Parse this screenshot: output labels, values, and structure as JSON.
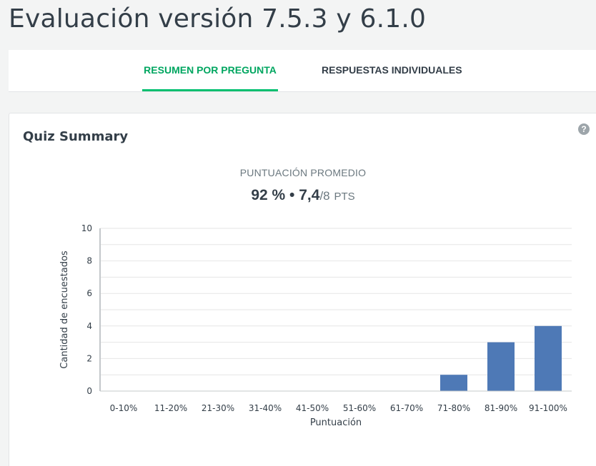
{
  "page": {
    "title": "Evaluación versión 7.5.3 y 6.1.0"
  },
  "tabs": [
    {
      "label": "RESUMEN POR PREGUNTA",
      "active": true
    },
    {
      "label": "RESPUESTAS INDIVIDUALES",
      "active": false
    }
  ],
  "card": {
    "title": "Quiz Summary",
    "help_icon": "question-circle-icon",
    "avg_label": "PUNTUACIÓN PROMEDIO",
    "avg_percent": "92 %",
    "avg_separator": "•",
    "avg_points": "7,4",
    "avg_points_total": "/8",
    "avg_points_unit": "PTS"
  },
  "colors": {
    "accent_green": "#00bf6f",
    "bar_blue": "#4e79b6",
    "text_dark": "#333e48"
  },
  "chart_data": {
    "type": "bar",
    "categories": [
      "0-10%",
      "11-20%",
      "21-30%",
      "31-40%",
      "41-50%",
      "51-60%",
      "61-70%",
      "71-80%",
      "81-90%",
      "91-100%"
    ],
    "values": [
      0,
      0,
      0,
      0,
      0,
      0,
      0,
      1,
      3,
      4
    ],
    "xlabel": "Puntuación",
    "ylabel": "Cantidad de encuestados",
    "ylim": [
      0,
      10
    ],
    "yticks": [
      0,
      2,
      4,
      6,
      8,
      10
    ],
    "grid": true
  }
}
